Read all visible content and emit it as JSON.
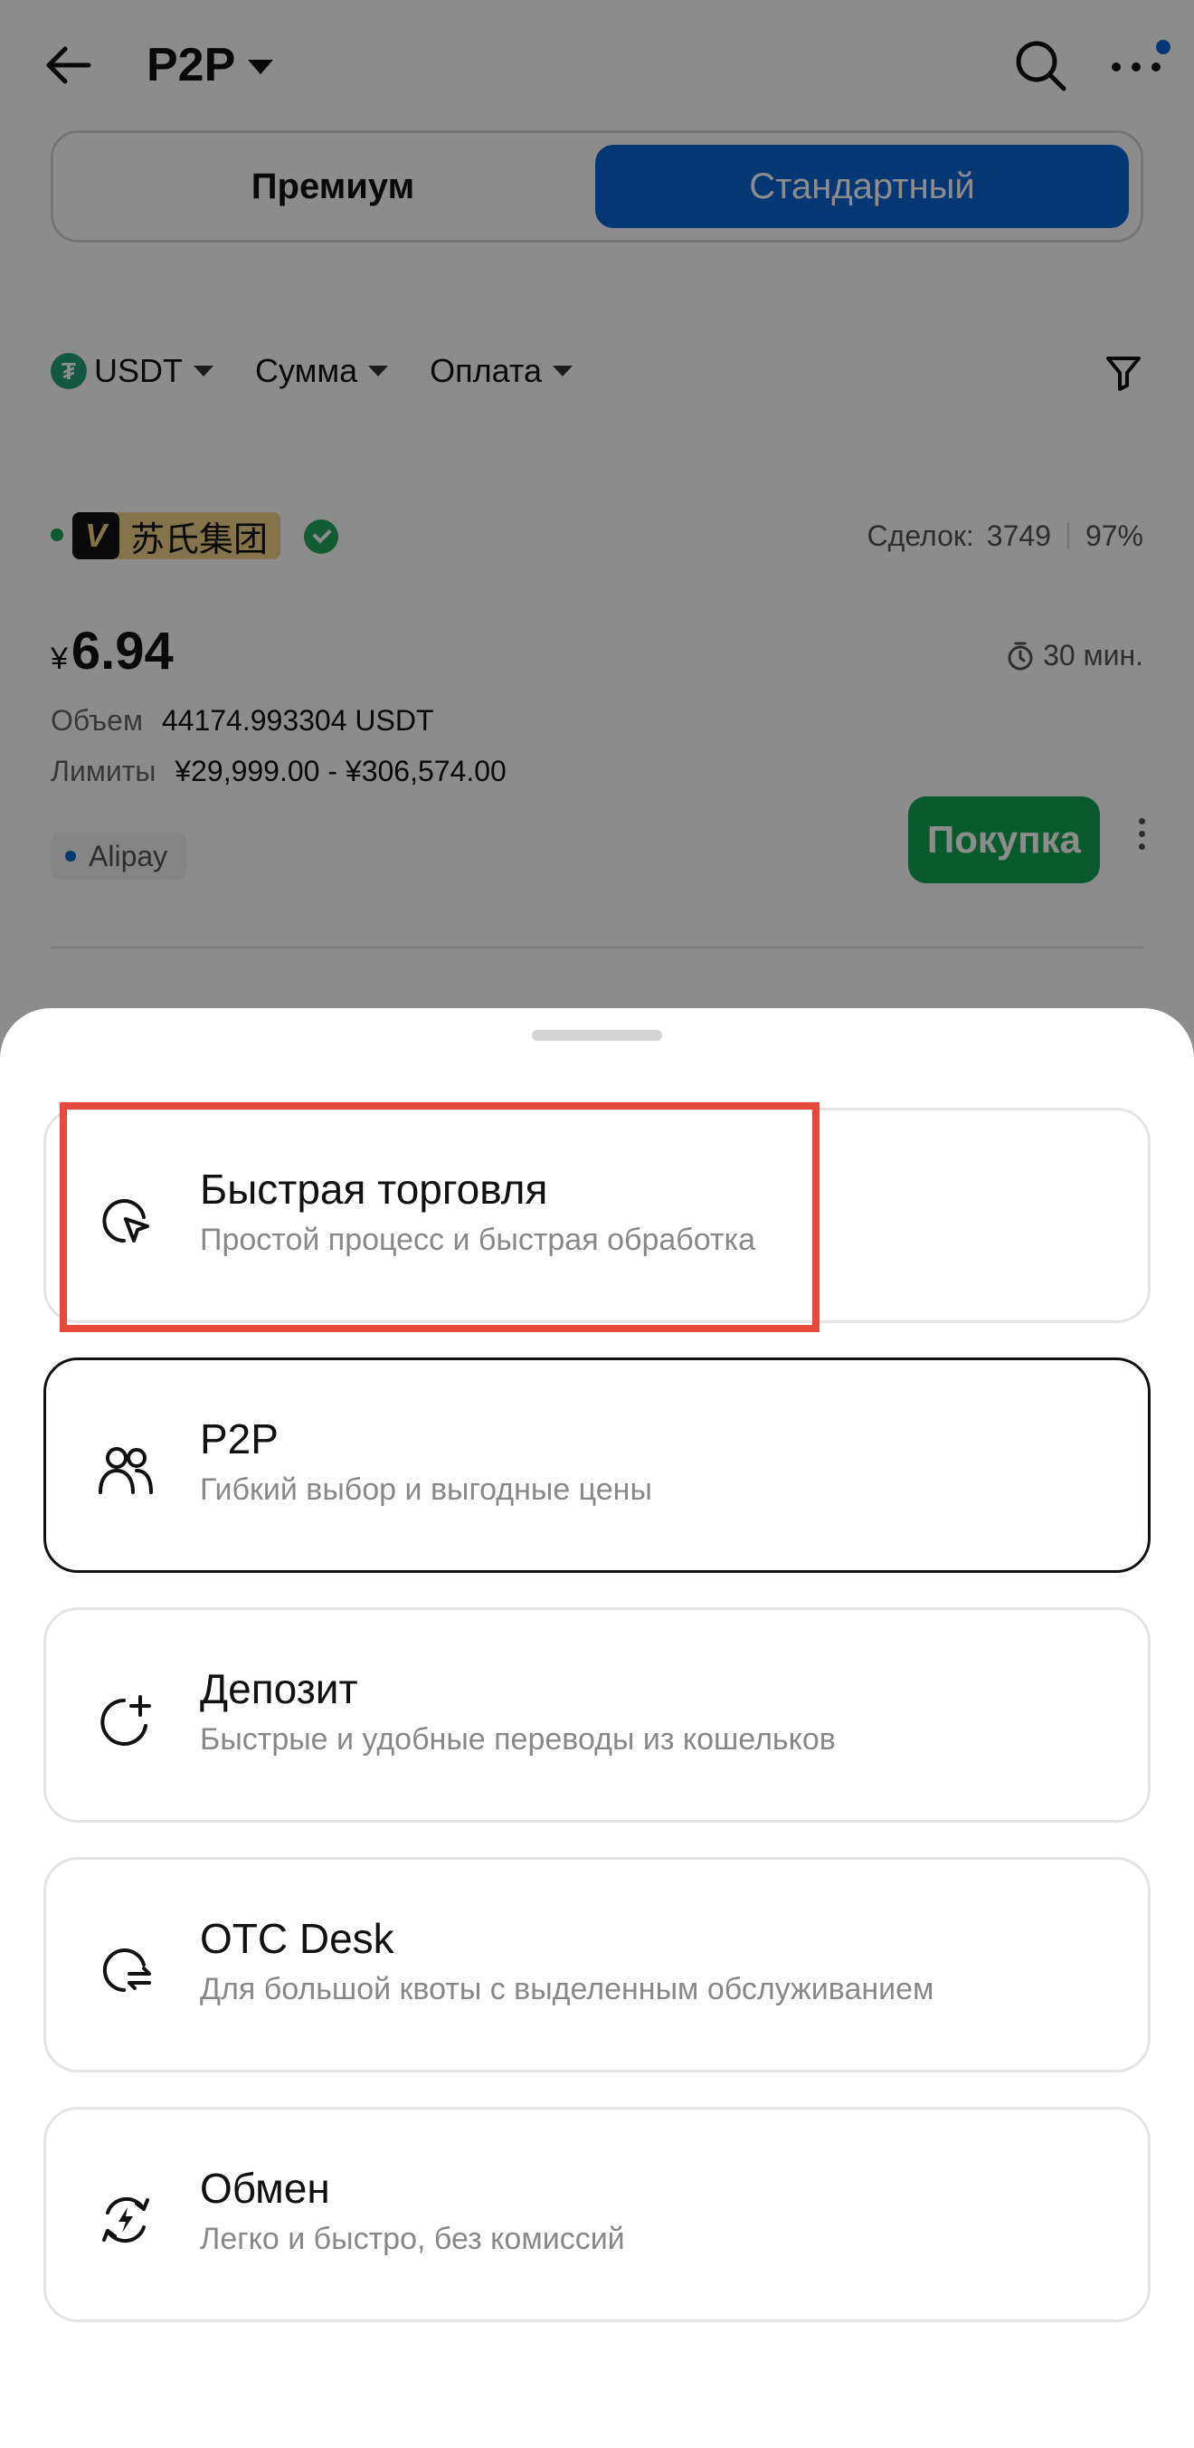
{
  "header": {
    "title": "P2P"
  },
  "segments": {
    "premium": "Премиум",
    "standard": "Стандартный"
  },
  "filters": {
    "coin": "USDT",
    "coin_icon": "₮",
    "amount": "Сумма",
    "payment": "Оплата"
  },
  "offer": {
    "merchant_badge": "V",
    "merchant_name": "苏氏集团",
    "deals_label": "Сделок:",
    "deals_count": "3749",
    "completion": "97%",
    "currency_symbol": "¥",
    "price": "6.94",
    "time_limit": "30 мин.",
    "volume_label": "Объем",
    "volume_value": "44174.993304 USDT",
    "limits_label": "Лимиты",
    "limits_value": "¥29,999.00 - ¥306,574.00",
    "payment_method": "Alipay",
    "buy_label": "Покупка"
  },
  "sheet": {
    "options": [
      {
        "title": "Быстрая торговля",
        "subtitle": "Простой процесс и быстрая обработка",
        "icon": "quick-trade-icon",
        "selected": false
      },
      {
        "title": "P2P",
        "subtitle": "Гибкий выбор и выгодные цены",
        "icon": "users-icon",
        "selected": true
      },
      {
        "title": "Депозит",
        "subtitle": "Быстрые и удобные переводы из кошельков",
        "icon": "deposit-icon",
        "selected": false
      },
      {
        "title": "OTC Desk",
        "subtitle": "Для большой квоты с выделенным обслуживанием",
        "icon": "otc-icon",
        "selected": false
      },
      {
        "title": "Обмен",
        "subtitle": "Легко и быстро, без комиссий",
        "icon": "exchange-icon",
        "selected": false
      }
    ]
  },
  "colors": {
    "accent": "#0a64d6",
    "buy": "#12a454",
    "highlight": "#e5493b"
  }
}
